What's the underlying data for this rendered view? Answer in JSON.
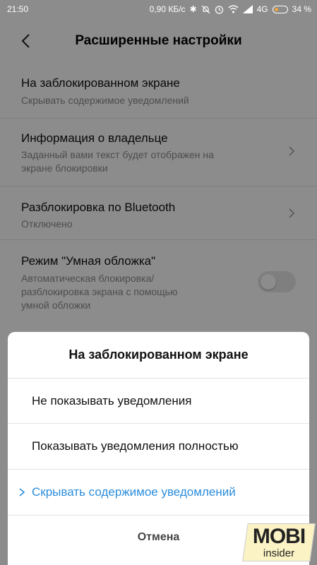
{
  "status_bar": {
    "time": "21:50",
    "network_speed": "0,90 КБ/с",
    "network_type": "4G",
    "battery_percent": "34 %",
    "battery_level": 0.34,
    "icons": [
      "bluetooth-icon",
      "mute-icon",
      "alarm-icon",
      "wifi-icon",
      "signal-icon",
      "battery-icon"
    ]
  },
  "header": {
    "title": "Расширенные настройки",
    "back_icon": "chevron-left-icon"
  },
  "settings": [
    {
      "title": "На заблокированном экране",
      "subtitle": "Скрывать содержимое уведомлений"
    },
    {
      "title": "Информация о владельце",
      "subtitle_line1": "Заданный вами текст будет отображен на",
      "subtitle_line2": "экране блокировки"
    },
    {
      "title": "Разблокировка по Bluetooth",
      "subtitle": "Отключено"
    },
    {
      "title": "Режим \"Умная обложка\"",
      "subtitle_line1": "Автоматическая блокировка/",
      "subtitle_line2": "разблокировка экрана с помощью",
      "subtitle_line3": "умной обложки",
      "toggle_on": false
    }
  ],
  "dialog": {
    "title": "На заблокированном экране",
    "options": [
      {
        "label": "Не показывать уведомления",
        "selected": false
      },
      {
        "label": "Показывать уведомления полностью",
        "selected": false
      },
      {
        "label": "Скрывать содержимое уведомлений",
        "selected": true
      }
    ],
    "cancel_label": "Отмена",
    "accent_color": "#2a8ddc"
  },
  "watermark": {
    "line1": "MOBI",
    "line2": "insider"
  }
}
